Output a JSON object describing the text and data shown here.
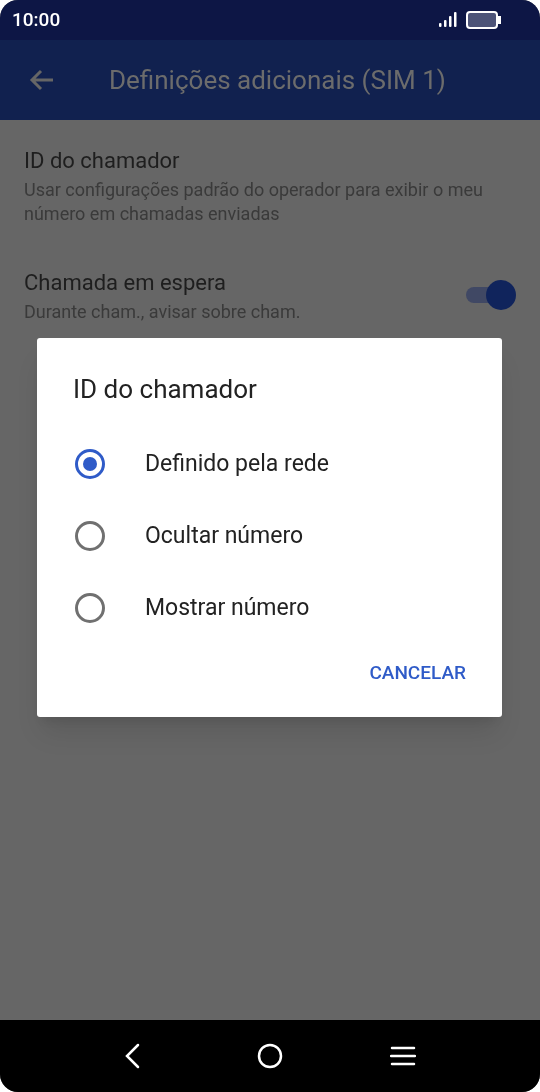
{
  "status_bar": {
    "time": "10:00"
  },
  "app_bar": {
    "title": "Definições adicionais (SIM 1)"
  },
  "settings": [
    {
      "kind": "text",
      "title": "ID do chamador",
      "summary": "Usar configurações padrão do operador para exibir o meu número em chamadas enviadas"
    },
    {
      "kind": "switch",
      "title": "Chamada em espera",
      "summary": "Durante cham., avisar sobre cham.",
      "on": true
    }
  ],
  "dialog": {
    "title": "ID do chamador",
    "options": [
      {
        "label": "Definido pela rede",
        "selected": true
      },
      {
        "label": "Ocultar número",
        "selected": false
      },
      {
        "label": "Mostrar número",
        "selected": false
      }
    ],
    "buttons": [
      "CANCELAR"
    ]
  }
}
